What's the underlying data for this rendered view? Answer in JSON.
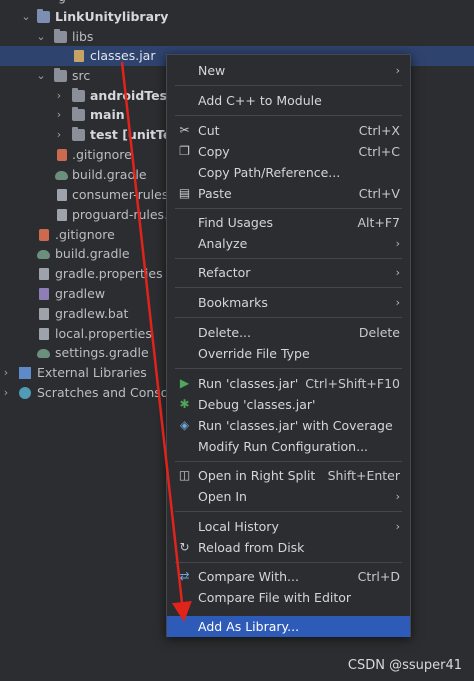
{
  "tree": {
    "top_partial": "g",
    "items": [
      {
        "label": "LinkUnitylibrary",
        "icon": "module-folder-icon",
        "bold": true,
        "arrow": "⌄"
      },
      {
        "label": "libs",
        "icon": "folder-icon",
        "arrow": "⌄"
      },
      {
        "label": "classes.jar",
        "icon": "jar-icon",
        "selected": true
      },
      {
        "label": "src",
        "icon": "folder-icon",
        "arrow": "⌄"
      },
      {
        "label": "androidTest",
        "icon": "folder-icon",
        "arrow": "›",
        "bold": true
      },
      {
        "label": "main",
        "icon": "folder-icon",
        "arrow": "›",
        "bold": true
      },
      {
        "label": "test [unitTest]",
        "icon": "folder-icon",
        "arrow": "›",
        "bold": true
      },
      {
        "label": ".gitignore",
        "icon": "git-file-icon"
      },
      {
        "label": "build.gradle",
        "icon": "gradle-icon"
      },
      {
        "label": "consumer-rules.pro",
        "icon": "file-icon"
      },
      {
        "label": "proguard-rules.pro",
        "icon": "file-icon"
      },
      {
        "label": ".gitignore",
        "icon": "git-file-icon"
      },
      {
        "label": "build.gradle",
        "icon": "gradle-icon"
      },
      {
        "label": "gradle.properties",
        "icon": "file-icon"
      },
      {
        "label": "gradlew",
        "icon": "file-icon"
      },
      {
        "label": "gradlew.bat",
        "icon": "file-icon"
      },
      {
        "label": "local.properties",
        "icon": "file-icon"
      },
      {
        "label": "settings.gradle",
        "icon": "gradle-icon"
      },
      {
        "label": "External Libraries",
        "icon": "library-icon",
        "arrow": "›"
      },
      {
        "label": "Scratches and Consoles",
        "icon": "scratches-icon",
        "arrow": "›"
      }
    ]
  },
  "menu": {
    "items": [
      {
        "label": "New",
        "submenu": true
      },
      {
        "label": "Add C++ to Module"
      },
      {
        "label": "Cut",
        "shortcut": "Ctrl+X",
        "icon": "cut-icon"
      },
      {
        "label": "Copy",
        "shortcut": "Ctrl+C",
        "icon": "copy-icon"
      },
      {
        "label": "Copy Path/Reference..."
      },
      {
        "label": "Paste",
        "shortcut": "Ctrl+V",
        "icon": "paste-icon"
      },
      {
        "label": "Find Usages",
        "shortcut": "Alt+F7"
      },
      {
        "label": "Analyze",
        "submenu": true
      },
      {
        "label": "Refactor",
        "submenu": true
      },
      {
        "label": "Bookmarks",
        "submenu": true
      },
      {
        "label": "Delete...",
        "shortcut": "Delete"
      },
      {
        "label": "Override File Type"
      },
      {
        "label": "Run 'classes.jar'",
        "shortcut": "Ctrl+Shift+F10",
        "icon": "run-icon"
      },
      {
        "label": "Debug 'classes.jar'",
        "icon": "debug-icon"
      },
      {
        "label": "Run 'classes.jar' with Coverage",
        "icon": "coverage-icon"
      },
      {
        "label": "Modify Run Configuration..."
      },
      {
        "label": "Open in Right Split",
        "shortcut": "Shift+Enter",
        "icon": "split-icon"
      },
      {
        "label": "Open In",
        "submenu": true
      },
      {
        "label": "Local History",
        "submenu": true
      },
      {
        "label": "Reload from Disk",
        "icon": "reload-icon"
      },
      {
        "label": "Compare With...",
        "shortcut": "Ctrl+D",
        "icon": "compare-icon"
      },
      {
        "label": "Compare File with Editor"
      },
      {
        "label": "Add As Library...",
        "highlighted": true
      }
    ]
  },
  "watermark": "CSDN @ssuper41",
  "colors": {
    "annotation_arrow": "#e0231b",
    "menu_highlight": "#2e5bb8",
    "tree_selection": "#2e436e"
  }
}
